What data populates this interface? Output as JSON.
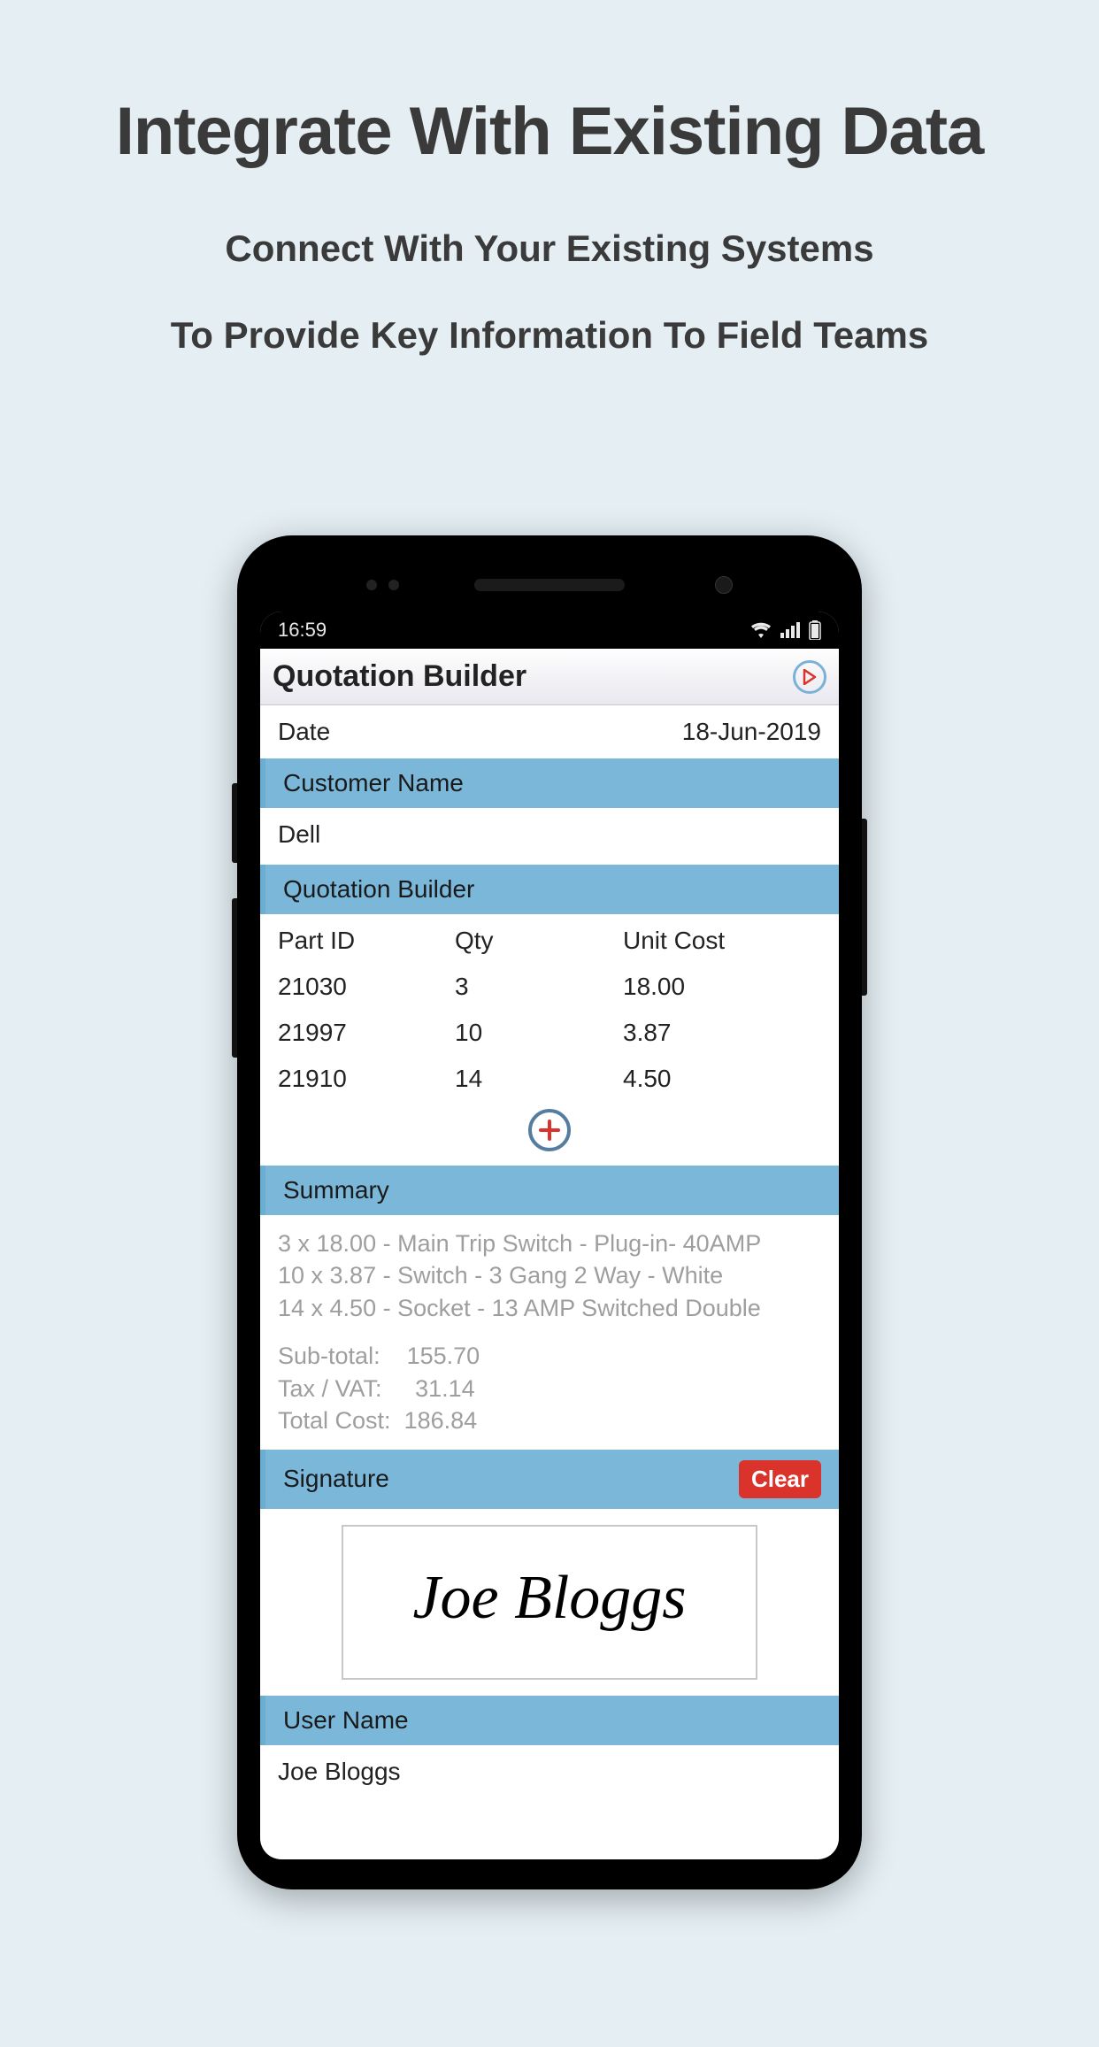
{
  "hero": {
    "title": "Integrate With Existing Data",
    "sub1": "Connect With Your Existing Systems",
    "sub2": "To Provide Key Information To Field Teams"
  },
  "statusbar": {
    "time": "16:59"
  },
  "app": {
    "title": "Quotation Builder",
    "date_label": "Date",
    "date_value": "18-Jun-2019",
    "customer_section": "Customer Name",
    "customer_value": "Dell",
    "builder_section": "Quotation Builder",
    "columns": {
      "part": "Part ID",
      "qty": "Qty",
      "cost": "Unit Cost"
    },
    "rows": [
      {
        "part": "21030",
        "qty": "3",
        "cost": "18.00"
      },
      {
        "part": "21997",
        "qty": "10",
        "cost": "3.87"
      },
      {
        "part": "21910",
        "qty": "14",
        "cost": "4.50"
      }
    ],
    "summary_section": "Summary",
    "summary_lines": [
      "3 x 18.00 - Main Trip Switch - Plug-in- 40AMP",
      "10 x 3.87 - Switch - 3 Gang  2 Way - White",
      "14 x 4.50 - Socket - 13 AMP Switched Double"
    ],
    "totals": {
      "sub_label": "Sub-total:",
      "sub_value": "155.70",
      "tax_label": "Tax / VAT:",
      "tax_value": "31.14",
      "total_label": "Total Cost:",
      "total_value": "186.84"
    },
    "signature_section": "Signature",
    "clear_label": "Clear",
    "signature_value": "Joe Bloggs",
    "username_section": "User Name",
    "username_value": "Joe Bloggs"
  }
}
